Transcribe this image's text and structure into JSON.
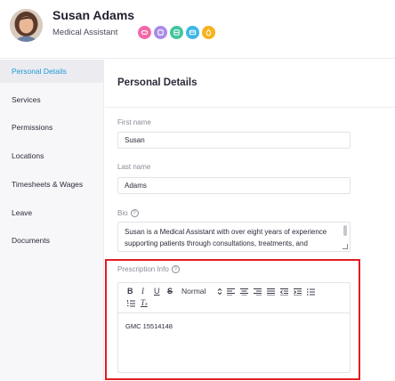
{
  "profile": {
    "name": "Susan Adams",
    "role": "Medical Assistant",
    "badges": [
      {
        "icon": "badge-icon-1",
        "color": "#f06aa8"
      },
      {
        "icon": "badge-icon-2",
        "color": "#a98be8"
      },
      {
        "icon": "badge-icon-3",
        "color": "#43c59e"
      },
      {
        "icon": "badge-icon-4",
        "color": "#3eb7e6"
      },
      {
        "icon": "badge-icon-5",
        "color": "#f6b21e"
      }
    ]
  },
  "sidebar": {
    "items": [
      {
        "label": "Personal Details",
        "active": true
      },
      {
        "label": "Services"
      },
      {
        "label": "Permissions"
      },
      {
        "label": "Locations"
      },
      {
        "label": "Timesheets & Wages"
      },
      {
        "label": "Leave"
      },
      {
        "label": "Documents"
      }
    ]
  },
  "main": {
    "title": "Personal Details",
    "first_name": {
      "label": "First name",
      "value": "Susan"
    },
    "last_name": {
      "label": "Last name",
      "value": "Adams"
    },
    "bio": {
      "label": "Bio",
      "value": "Susan is a Medical Assistant with over eight years of experience supporting patients through consultations, treatments, and"
    },
    "prescription": {
      "label": "Prescription Info",
      "format": "Normal",
      "value": "GMC 15514148"
    }
  },
  "colors": {
    "accent": "#1e9bd7",
    "highlight": "#e11d23"
  }
}
